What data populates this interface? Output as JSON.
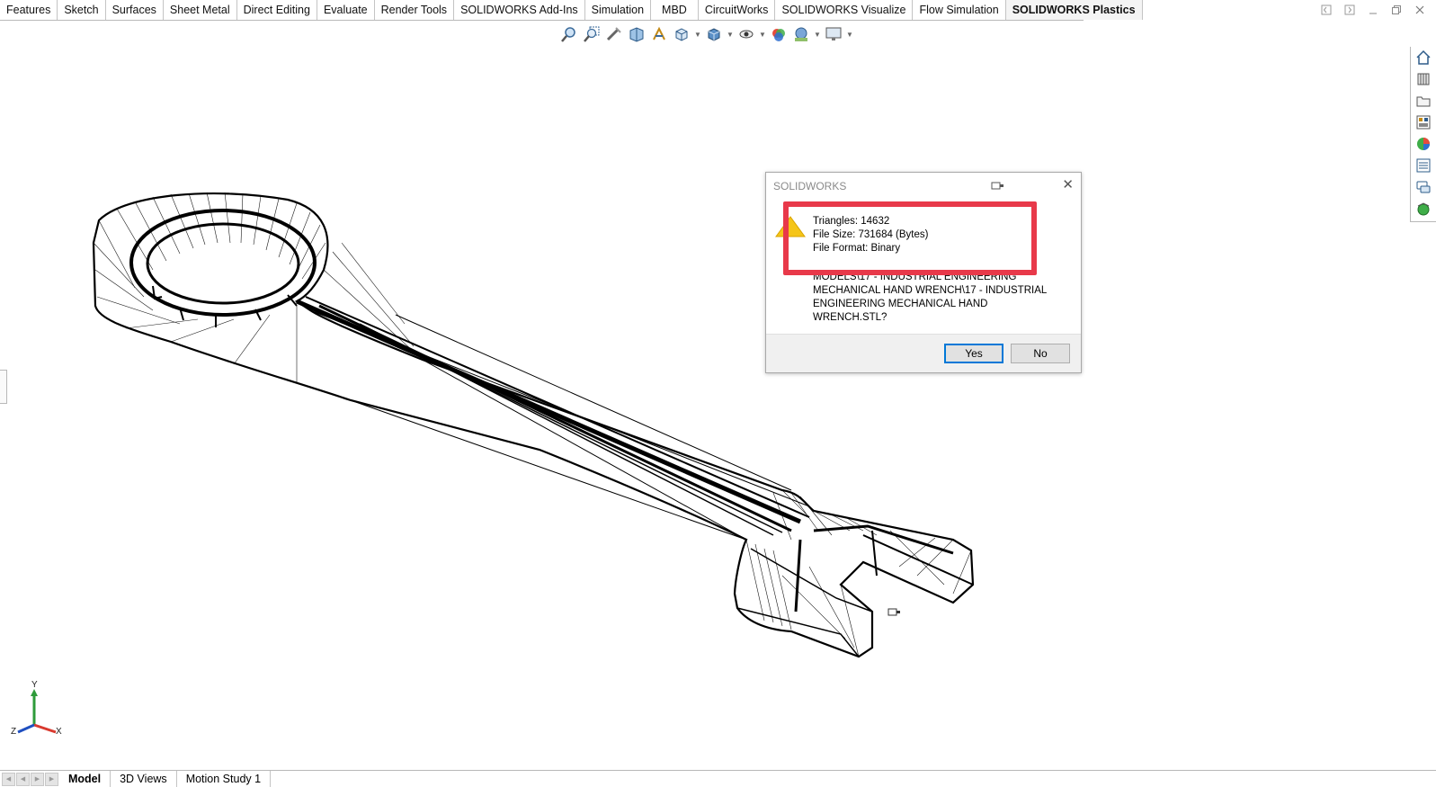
{
  "command_tabs": [
    {
      "label": "Features"
    },
    {
      "label": "Sketch"
    },
    {
      "label": "Surfaces"
    },
    {
      "label": "Sheet Metal"
    },
    {
      "label": "Direct Editing"
    },
    {
      "label": "Evaluate"
    },
    {
      "label": "Render Tools"
    },
    {
      "label": "SOLIDWORKS Add-Ins"
    },
    {
      "label": "Simulation"
    },
    {
      "label": "MBD"
    },
    {
      "label": "CircuitWorks"
    },
    {
      "label": "SOLIDWORKS Visualize"
    },
    {
      "label": "Flow Simulation"
    },
    {
      "label": "SOLIDWORKS Plastics"
    }
  ],
  "active_command_tab": "SOLIDWORKS Plastics",
  "dialog": {
    "title": "SOLIDWORKS",
    "info_lines": [
      "Triangles: 14632",
      "File Size: 731684 (Bytes)",
      "File Format: Binary"
    ],
    "path_lines": [
      "MODELS\\17 - INDUSTRIAL ENGINEERING",
      "MECHANICAL HAND WRENCH\\17 - INDUSTRIAL",
      "ENGINEERING MECHANICAL HAND WRENCH.STL?"
    ],
    "yes_label": "Yes",
    "no_label": "No"
  },
  "triad": {
    "y": "Y",
    "x": "X",
    "z": "Z"
  },
  "bottom_tabs": [
    {
      "label": "Model"
    },
    {
      "label": "3D Views"
    },
    {
      "label": "Motion Study 1"
    }
  ],
  "active_bottom_tab": "Model",
  "colors": {
    "highlight": "#e8394a",
    "accent": "#0078d7",
    "warning": "#f5c518"
  },
  "icons": {
    "hud": [
      "zoom-to-fit-icon",
      "zoom-area-icon",
      "previous-view-icon",
      "section-view-icon",
      "dynamic-annotation-icon",
      "view-orientation-icon",
      "display-style-icon",
      "hide-show-icon",
      "edit-appearance-icon",
      "apply-scene-icon",
      "view-settings-icon"
    ],
    "task_pane": [
      "home-icon",
      "design-library-icon",
      "file-explorer-icon",
      "view-palette-icon",
      "appearances-icon",
      "custom-properties-icon",
      "forum-icon",
      "3dcontent-icon"
    ]
  }
}
